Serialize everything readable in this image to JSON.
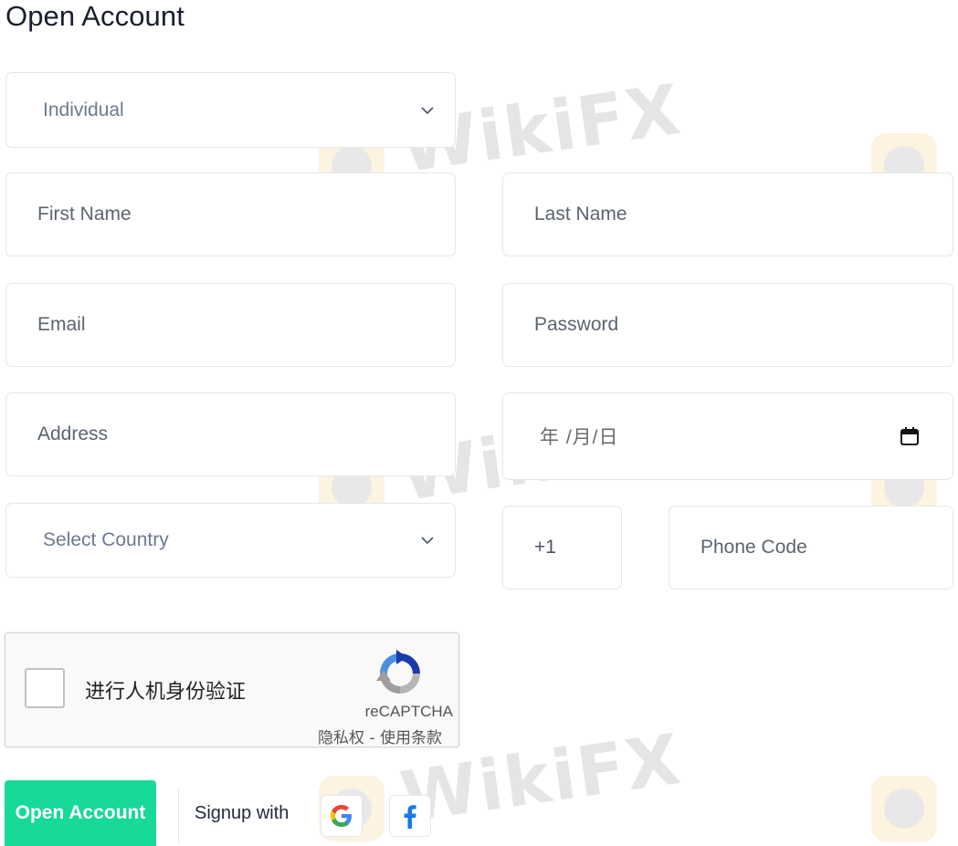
{
  "page": {
    "title": "Open Account"
  },
  "form": {
    "account_type": "Individual",
    "first_name_placeholder": "First Name",
    "last_name_placeholder": "Last Name",
    "email_placeholder": "Email",
    "password_placeholder": "Password",
    "address_placeholder": "Address",
    "dob_placeholder": "年 /月/日",
    "country_placeholder": "Select Country",
    "dial_code": "+1",
    "phone_placeholder": "Phone Code"
  },
  "captcha": {
    "label": "进行人机身份验证",
    "brand": "reCAPTCHA",
    "links": "隐私权 - 使用条款"
  },
  "actions": {
    "open_account_label": "Open Account",
    "signup_with_label": "Signup with",
    "google_icon": "google-icon",
    "facebook_icon": "facebook-icon"
  },
  "watermark": {
    "text": "WikiFX"
  },
  "colors": {
    "accent": "#17d99a",
    "border": "#e5e7eb",
    "facebook": "#1877f2"
  }
}
